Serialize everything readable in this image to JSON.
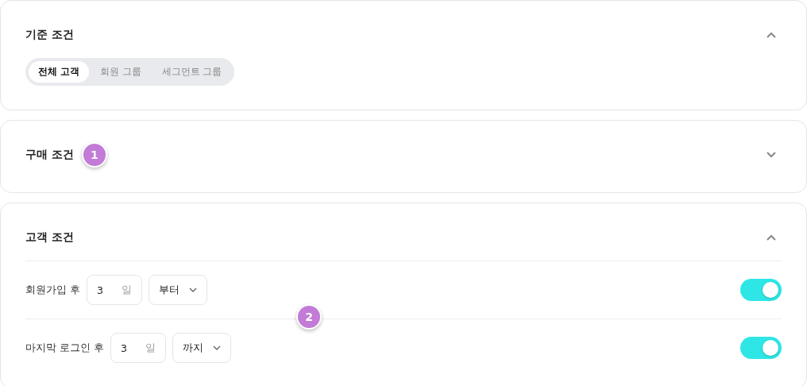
{
  "sections": [
    {
      "title": "기준 조건",
      "expanded": true,
      "segments": [
        {
          "label": "전체 고객",
          "selected": true
        },
        {
          "label": "회원 그룹",
          "selected": false
        },
        {
          "label": "세그먼트 그룹",
          "selected": false
        }
      ]
    },
    {
      "title": "구매 조건",
      "expanded": false,
      "badge": "1"
    },
    {
      "title": "고객 조건",
      "expanded": true,
      "badge_over_rows": "2",
      "rows": [
        {
          "label": "회원가입 후",
          "value": "3",
          "unit": "일",
          "select": "부터",
          "on": true
        },
        {
          "label": "마지막 로그인 후",
          "value": "3",
          "unit": "일",
          "select": "까지",
          "on": true
        }
      ]
    }
  ]
}
